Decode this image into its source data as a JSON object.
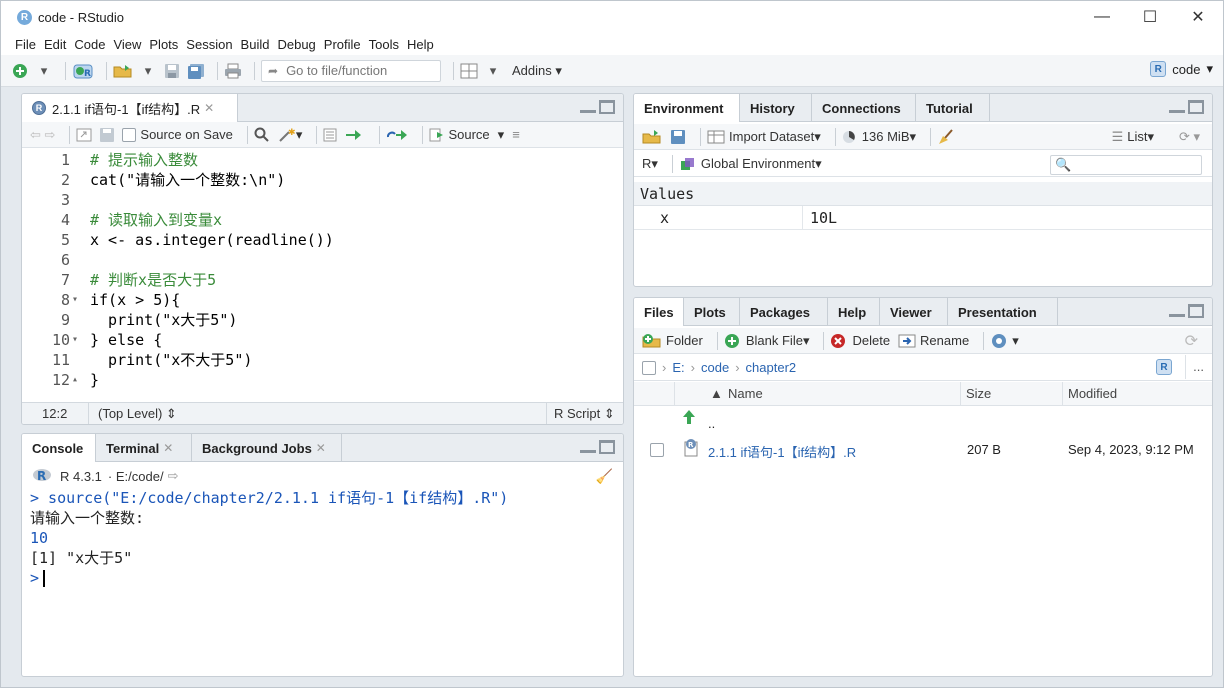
{
  "window": {
    "title": "code - RStudio",
    "icon_letter": "R"
  },
  "window_controls": {
    "minimize": "—",
    "maximize": "☐",
    "close": "✕"
  },
  "menu": [
    "File",
    "Edit",
    "Code",
    "View",
    "Plots",
    "Session",
    "Build",
    "Debug",
    "Profile",
    "Tools",
    "Help"
  ],
  "toolbar": {
    "goto_placeholder": "Go to file/function",
    "addins_label": "Addins",
    "project_label": "code"
  },
  "editor": {
    "tab_label": "2.1.1 if语句-1【if结构】.R",
    "source_on_save": "Source on Save",
    "source_label": "Source",
    "lines": [
      {
        "n": "1",
        "fold": "",
        "text": "# 提示输入整数",
        "comment": true
      },
      {
        "n": "2",
        "fold": "",
        "text": "cat(\"请输入一个整数:\\n\")",
        "comment": false
      },
      {
        "n": "3",
        "fold": "",
        "text": "",
        "comment": false
      },
      {
        "n": "4",
        "fold": "",
        "text": "# 读取输入到变量x",
        "comment": true
      },
      {
        "n": "5",
        "fold": "",
        "text": "x <- as.integer(readline())",
        "comment": false
      },
      {
        "n": "6",
        "fold": "",
        "text": "",
        "comment": false
      },
      {
        "n": "7",
        "fold": "",
        "text": "# 判断x是否大于5",
        "comment": true
      },
      {
        "n": "8",
        "fold": "▾",
        "text": "if(x > 5){",
        "comment": false
      },
      {
        "n": "9",
        "fold": "",
        "text": "  print(\"x大于5\")",
        "comment": false
      },
      {
        "n": "10",
        "fold": "▾",
        "text": "} else {",
        "comment": false
      },
      {
        "n": "11",
        "fold": "",
        "text": "  print(\"x不大于5\")",
        "comment": false
      },
      {
        "n": "12",
        "fold": "▴",
        "text": "}",
        "comment": false
      }
    ],
    "status": {
      "position": "12:2",
      "scope": "(Top Level) ⇕",
      "filetype": "R Script ⇕"
    }
  },
  "console": {
    "tabs": [
      {
        "label": "Console"
      },
      {
        "label": "Terminal"
      },
      {
        "label": "Background Jobs"
      }
    ],
    "version": "R 4.3.1",
    "path": "· E:/code/",
    "lines": [
      {
        "text": "> source(\"E:/code/chapter2/2.1.1 if语句-1【if结构】.R\")",
        "kind": "prompt"
      },
      {
        "text": "请输入一个整数:",
        "kind": "out"
      },
      {
        "text": "10",
        "kind": "input"
      },
      {
        "text": "[1] \"x大于5\"",
        "kind": "out"
      }
    ],
    "prompt": ">"
  },
  "environment": {
    "tabs": [
      {
        "label": "Environment"
      },
      {
        "label": "History"
      },
      {
        "label": "Connections"
      },
      {
        "label": "Tutorial"
      }
    ],
    "import_label": "Import Dataset",
    "memory_label": "136 MiB",
    "list_label": "List",
    "lang": "R",
    "scope": "Global Environment",
    "section": "Values",
    "var_name": "x",
    "var_value": "10L"
  },
  "files": {
    "tabs": [
      {
        "label": "Files"
      },
      {
        "label": "Plots"
      },
      {
        "label": "Packages"
      },
      {
        "label": "Help"
      },
      {
        "label": "Viewer"
      },
      {
        "label": "Presentation"
      }
    ],
    "folder_label": "Folder",
    "blank_label": "Blank File",
    "delete_label": "Delete",
    "rename_label": "Rename",
    "breadcrumb": [
      "E:",
      "code",
      "chapter2"
    ],
    "more_label": "...",
    "columns": {
      "name": "Name",
      "size": "Size",
      "modified": "Modified"
    },
    "up_label": "..",
    "rows": [
      {
        "name": "2.1.1 if语句-1【if结构】.R",
        "size": "207 B",
        "modified": "Sep 4, 2023, 9:12 PM"
      }
    ]
  }
}
